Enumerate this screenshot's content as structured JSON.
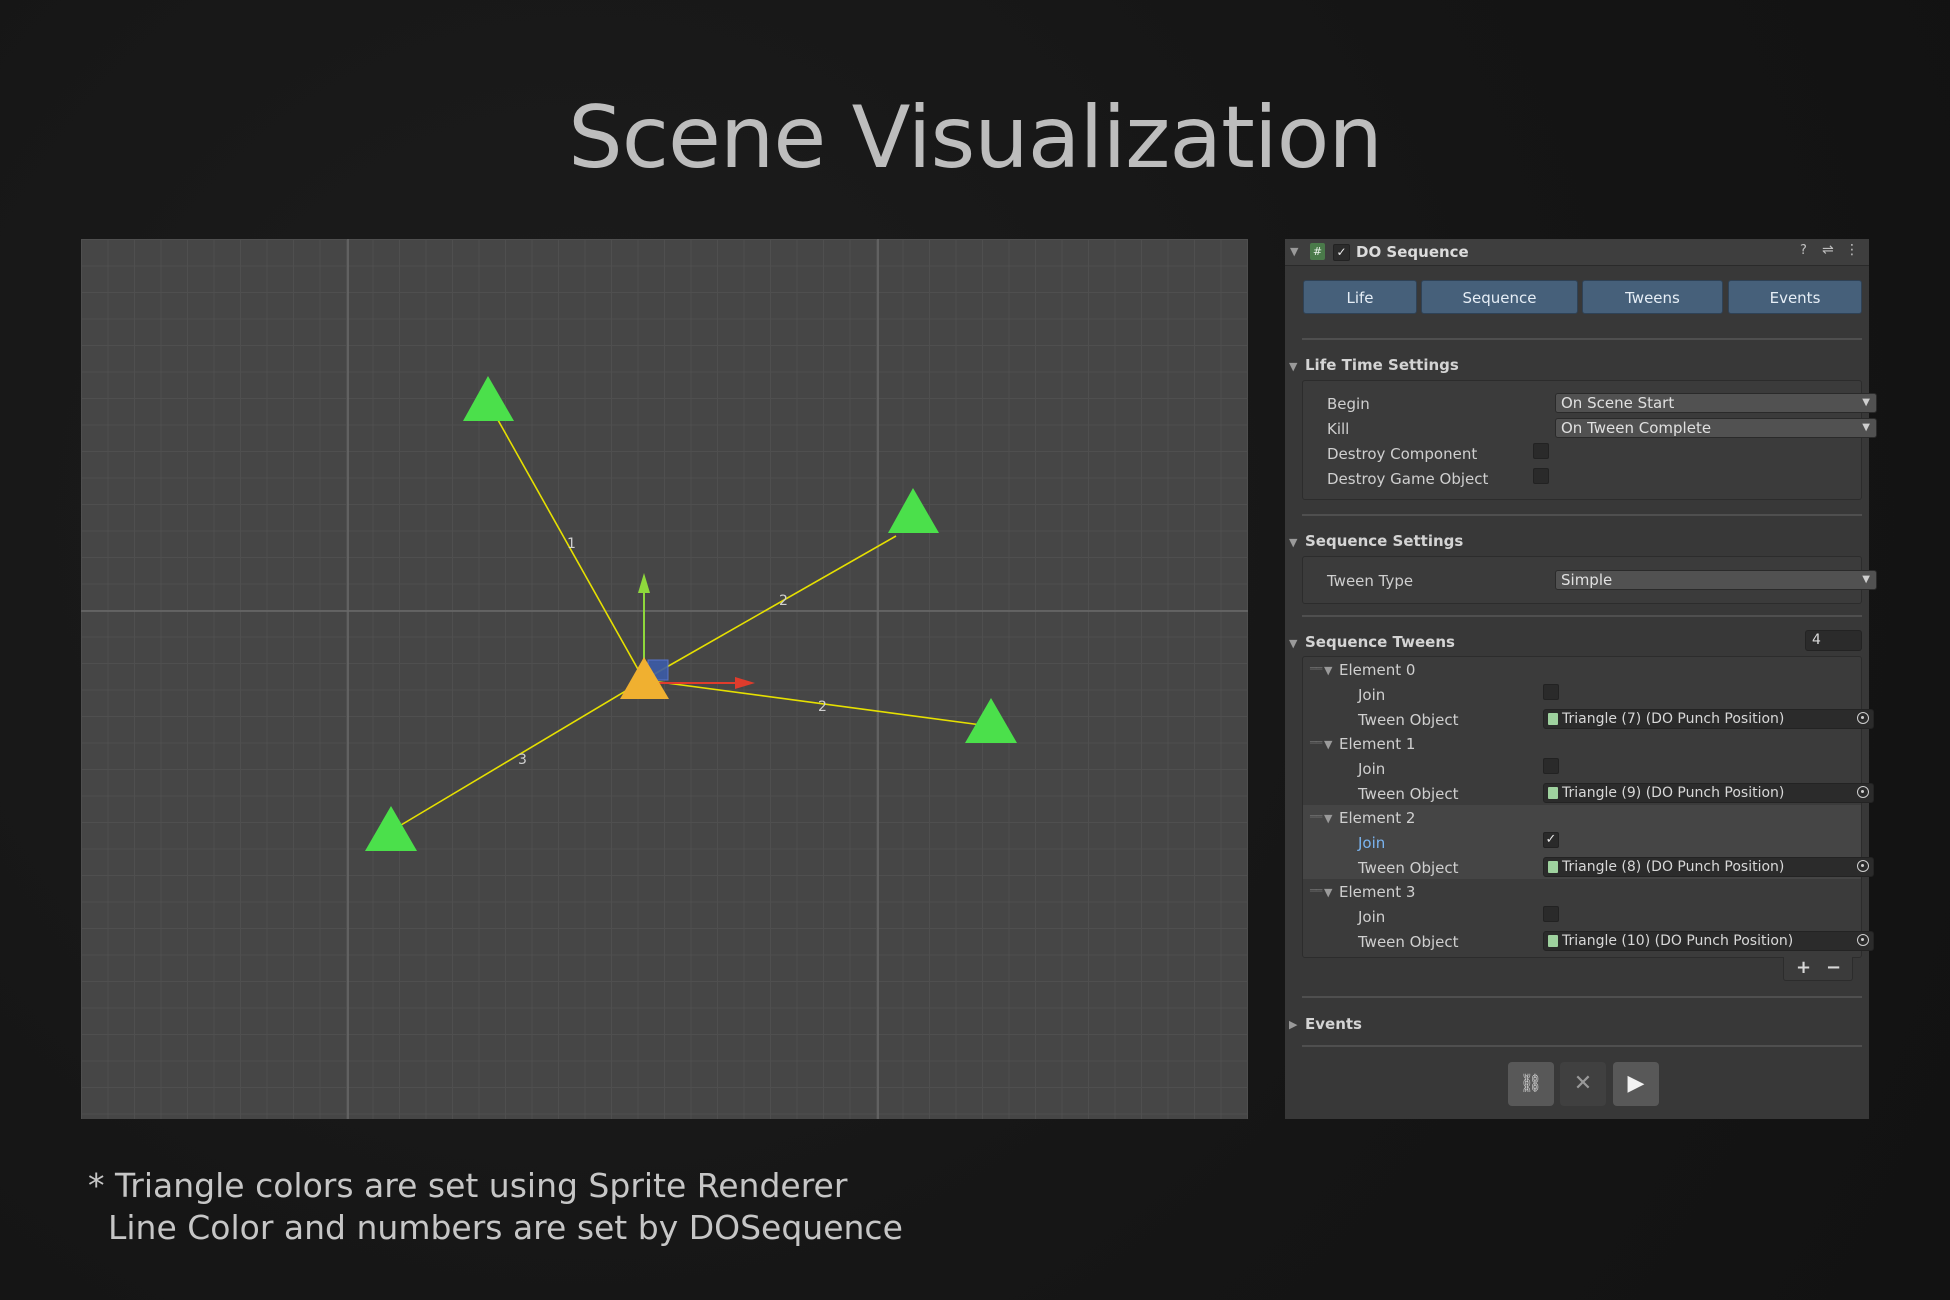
{
  "headline": "Scene Visualization",
  "scene": {
    "line_color": "#e6e000",
    "triangle_color": "#4be04b",
    "center_color": "#f0b030",
    "line_labels": [
      "1",
      "2",
      "2",
      "3"
    ]
  },
  "inspector": {
    "component_title": "DO Sequence",
    "tabs": [
      "Life",
      "Sequence",
      "Tweens",
      "Events"
    ],
    "life": {
      "title": "Life Time Settings",
      "begin_label": "Begin",
      "begin_value": "On Scene Start",
      "kill_label": "Kill",
      "kill_value": "On Tween Complete",
      "destroy_component_label": "Destroy Component",
      "destroy_game_object_label": "Destroy Game Object"
    },
    "sequence": {
      "title": "Sequence Settings",
      "tween_type_label": "Tween Type",
      "tween_type_value": "Simple"
    },
    "tweens": {
      "title": "Sequence Tweens",
      "count": "4",
      "join_label": "Join",
      "tween_object_label": "Tween Object",
      "elements": [
        {
          "name": "Element 0",
          "join": false,
          "object": "Triangle (7) (DO Punch Position)"
        },
        {
          "name": "Element 1",
          "join": false,
          "object": "Triangle (9) (DO Punch Position)"
        },
        {
          "name": "Element 2",
          "join": true,
          "object": "Triangle (8) (DO Punch Position)"
        },
        {
          "name": "Element 3",
          "join": false,
          "object": "Triangle (10) (DO Punch Position)"
        }
      ],
      "add": "+",
      "remove": "−"
    },
    "events_title": "Events"
  },
  "footnote": {
    "line1": "* Triangle colors are set using Sprite Renderer",
    "line2": "Line Color and numbers are set by DOSequence"
  }
}
